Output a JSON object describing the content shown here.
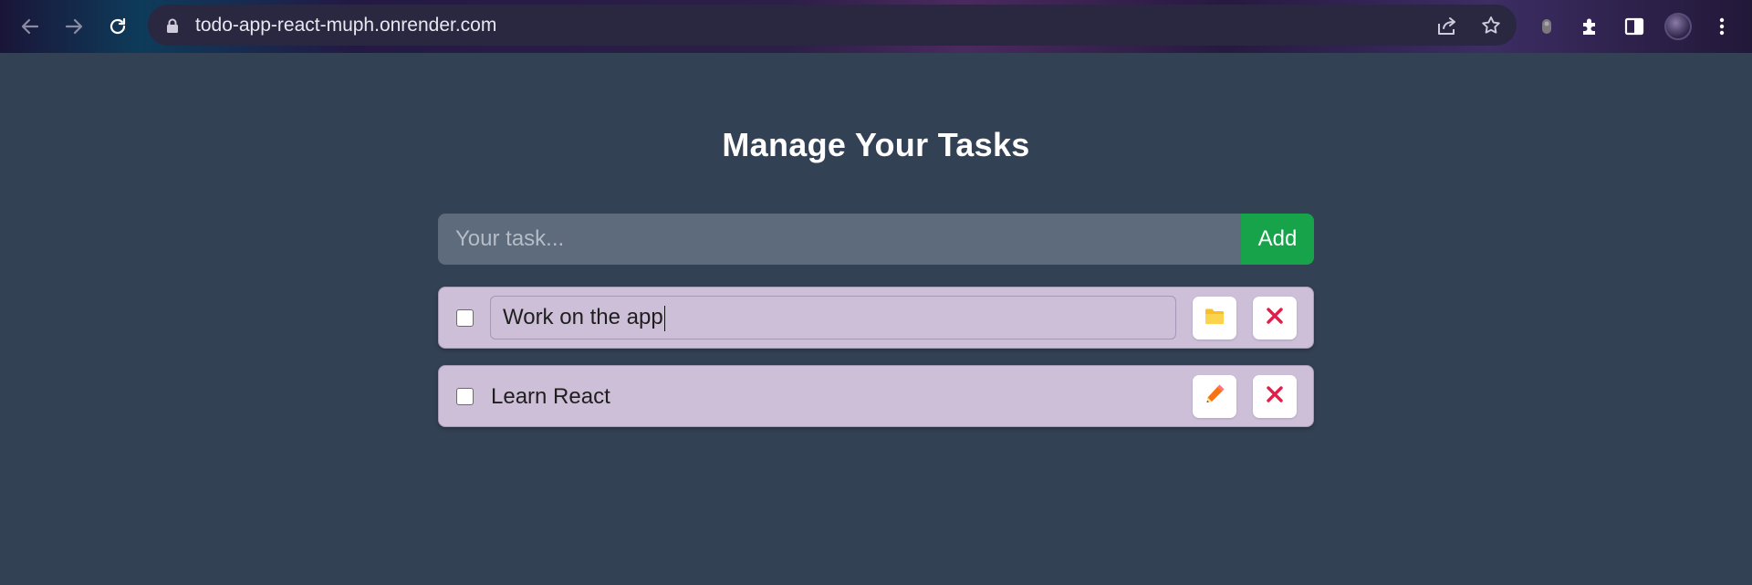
{
  "browser": {
    "url": "todo-app-react-muph.onrender.com",
    "icons": [
      "back-icon",
      "forward-icon",
      "reload-icon",
      "lock-icon",
      "share-icon",
      "star-icon",
      "extension-icon",
      "puzzle-icon",
      "side-panel-icon",
      "profile-avatar",
      "menu-icon"
    ]
  },
  "app": {
    "title": "Manage Your Tasks",
    "input_placeholder": "Your task...",
    "add_label": "Add",
    "tasks": [
      {
        "text": "Work on the app",
        "editing": true,
        "done": false,
        "action_icon": "folder-icon",
        "delete_icon": "close-icon"
      },
      {
        "text": "Learn React",
        "editing": false,
        "done": false,
        "action_icon": "pencil-icon",
        "delete_icon": "close-icon"
      }
    ]
  },
  "colors": {
    "background": "#334155",
    "input_bg": "#5d6b7c",
    "add_button": "#16a34a",
    "task_bg": "#cdbfd7",
    "delete_x": "#e11d48",
    "folder": "#fbbf24",
    "pencil": "#f97316"
  }
}
